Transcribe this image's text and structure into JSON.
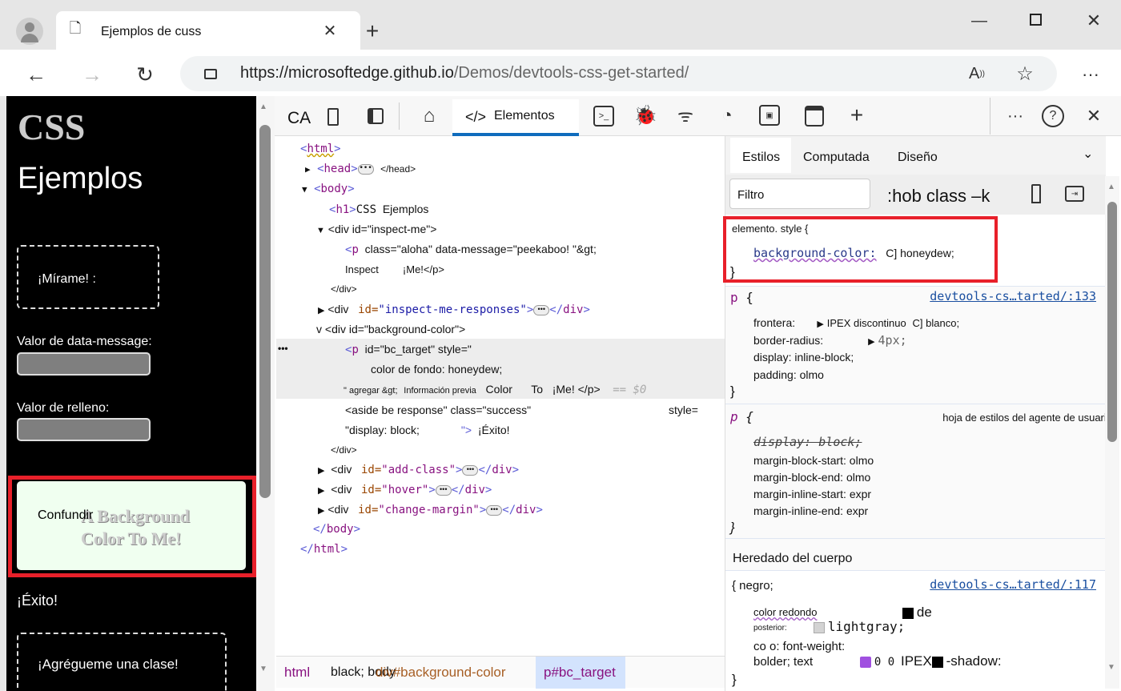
{
  "browser": {
    "tab_title": "Ejemplos de cuss",
    "url_host": "https://microsoftedge.github.io",
    "url_path": "/Demos/devtools-css-get-started/"
  },
  "page": {
    "h1_css": "CSS",
    "h1_rest": "Ejemplos",
    "inspect_me": "¡Mírame! :",
    "data_message_label": "Valor de data-message:",
    "padding_label": "Valor de relleno:",
    "confundir": "Confundir",
    "bg_text": "A Background Color To Me!",
    "success": "¡Éxito!",
    "add_class": "¡Agrégueme una clase!"
  },
  "devtools": {
    "toolbar": {
      "ca": "CA",
      "elements_tab": "Elementos"
    },
    "tree": {
      "html_open": "html",
      "head": "head",
      "head_close": "</head>",
      "body": "body",
      "h1": "h1",
      "h1_text": "CSS",
      "h1_text2": "Ejemplos",
      "div_inspect": "<div id=\"inspect-me\">",
      "p_attrs": "class=\"aloha\" data-message=\"peekaboo! \"&gt;",
      "p_text1": "Inspect",
      "p_text2": "¡Me!</p>",
      "div_close": "</div>",
      "div_word": "<div",
      "responses_id": "id=",
      "responses_val": "\"inspect-me-responses\"",
      "bgc_div": "v <div id=\"background-color\">",
      "sel_p_attrs": "id=\"bc_target\" style=\"",
      "sel_style": "color de fondo: honeydew;",
      "sel_line3a": "\" agregar &gt;",
      "sel_line3b": "Información previa",
      "sel_line3c": "Color",
      "sel_line3d": "To",
      "sel_line3e": "¡Me! </p>",
      "sel_eq": "== $0",
      "aside1": "<aside be response\" class=\"success\"",
      "aside_style": "style=",
      "aside2": "\"display: block;",
      "aside_close": "\">",
      "aside_text": "¡Éxito!",
      "add_class": "\"add-class\"",
      "hover": "\"hover\"",
      "change_margin": "\"change-margin\"",
      "body_close": "body",
      "html_close": "html"
    },
    "breadcrumb": {
      "html": "html",
      "body": "black; body",
      "div": "div#background-color",
      "p": "p#bc_target"
    },
    "styles": {
      "tabs": [
        "Estilos",
        "Computada",
        "Diseño"
      ],
      "filter_placeholder": "Filtro",
      "hov_cls": ":hob class –k",
      "element_style": "elemento. style {",
      "bg_prop": "background-color:",
      "bg_val": "C] honeydew;",
      "p_rule_source": "devtools-cs…tarted/:133",
      "frontera": "frontera:",
      "frontera_val": "IPEX discontinuo",
      "frontera_val2": "C] blanco;",
      "border_radius": "border-radius:",
      "border_radius_val": "4px;",
      "display": "display: inline-block;",
      "padding": "padding: olmo",
      "ua_label": "hoja de estilos del agente de usuario",
      "ua_display": "display: block;",
      "ua_lines": [
        "margin-block-start: olmo",
        "margin-block-end: olmo",
        "margin-inline-start: expr",
        "margin-inline-end: expr"
      ],
      "inherited": "Heredado del cuerpo",
      "body_sel": "{ negro;",
      "body_source": "devtools-cs…tarted/:117",
      "b1": "color redondo",
      "b1_val": "de",
      "b2": "posterior:",
      "b2_val": "lightgray;",
      "b3": "co o: font-weight:",
      "b4": "bolder; text",
      "b4_val": "0 0",
      "b4_ipex": "IPEX",
      "b4_end": "-shadow:",
      "open": "{",
      "close": "}",
      "p": "p"
    }
  }
}
